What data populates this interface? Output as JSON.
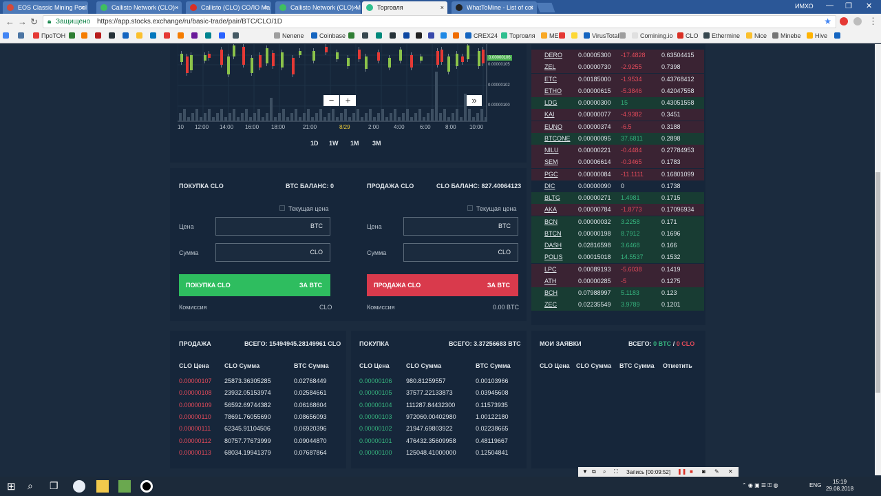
{
  "browser": {
    "tabs": [
      {
        "title": "EOS Classic Mining Pool",
        "left": 0,
        "color": "#d44a3a"
      },
      {
        "title": "Callisto Network (CLO) -",
        "left": 136,
        "color": "#3fbf5f"
      },
      {
        "title": "Callisto (CLO) СОЛО Ма",
        "left": 266,
        "color": "#d93025"
      },
      {
        "title": "Callisto Network (CLO) М",
        "left": 396,
        "color": "#3fbf5f"
      },
      {
        "title": "Торговля",
        "left": 522,
        "color": "#2fbf8f"
      },
      {
        "title": "WhatToMine - List of coi",
        "left": 652,
        "color": "#222222"
      }
    ],
    "user": "ИМХО",
    "secure_label": "Защищено",
    "url": "https://app.stocks.exchange/ru/basic-trade/pair/BTC/CLO/1D",
    "bookmarks": [
      "ПроТОН",
      "Nenene",
      "Coinbase",
      "CREX24",
      "Торговля",
      "ME",
      "VirusTotal",
      "Comining.io",
      "CLO",
      "Ethermine",
      "Nice",
      "Minebe",
      "Hive"
    ]
  },
  "chart": {
    "x_ticks": [
      "10",
      "12:00",
      "14:00",
      "16:00",
      "18:00",
      "21:00",
      "8/29",
      "2:00",
      "4:00",
      "6:00",
      "8:00",
      "10:00"
    ],
    "y_ticks": [
      "0.00000106",
      "0.00000105",
      "0.00000102",
      "0.00000100"
    ],
    "last_price": "0.00000106",
    "ranges": [
      "1D",
      "1W",
      "1M",
      "3M"
    ]
  },
  "buy": {
    "title": "ПОКУПКА CLO",
    "balance": "BTC БАЛАНС: 0",
    "current_price": "Текущая цена",
    "price_label": "Цена",
    "price_unit": "BTC",
    "amount_label": "Сумма",
    "amount_unit": "CLO",
    "button_left": "ПОКУПКА CLO",
    "button_right": "ЗА BTC",
    "fee_label": "Комиссия",
    "fee_value": "CLO"
  },
  "sell": {
    "title": "ПРОДАЖА CLO",
    "balance": "CLO БАЛАНС: 827.40064123",
    "current_price": "Текущая цена",
    "price_label": "Цена",
    "price_unit": "BTC",
    "amount_label": "Сумма",
    "amount_unit": "CLO",
    "button_left": "ПРОДАЖА CLO",
    "button_right": "ЗА BTC",
    "fee_label": "Комиссия",
    "fee_value": "0.00 BTC"
  },
  "asks": {
    "title": "ПРОДАЖА",
    "total": "ВСЕГО: 15494945.28149961 CLO",
    "headers": [
      "CLO Цена",
      "CLO Сумма",
      "BTC Сумма"
    ],
    "rows": [
      [
        "0.00000107",
        "25873.36305285",
        "0.02768449"
      ],
      [
        "0.00000108",
        "23932.05153974",
        "0.02584661"
      ],
      [
        "0.00000109",
        "56592.69744382",
        "0.06168604"
      ],
      [
        "0.00000110",
        "78691.76055690",
        "0.08656093"
      ],
      [
        "0.00000111",
        "62345.91104506",
        "0.06920396"
      ],
      [
        "0.00000112",
        "80757.77673999",
        "0.09044870"
      ],
      [
        "0.00000113",
        "68034.19941379",
        "0.07687864"
      ]
    ]
  },
  "bids": {
    "title": "ПОКУПКА",
    "total": "ВСЕГО: 3.37256683 BTC",
    "headers": [
      "CLO Цена",
      "CLO Сумма",
      "BTC Сумма"
    ],
    "rows": [
      [
        "0.00000106",
        "980.81259557",
        "0.00103966"
      ],
      [
        "0.00000105",
        "37577.22133873",
        "0.03945608"
      ],
      [
        "0.00000104",
        "111287.84432300",
        "0.11573935"
      ],
      [
        "0.00000103",
        "972060.00402980",
        "1.00122180"
      ],
      [
        "0.00000102",
        "21947.69803922",
        "0.02238665"
      ],
      [
        "0.00000101",
        "476432.35609958",
        "0.48119667"
      ],
      [
        "0.00000100",
        "125048.41000000",
        "0.12504841"
      ]
    ]
  },
  "my_orders": {
    "title": "МОИ ЗАЯВКИ",
    "total_prefix": "ВСЕГО:",
    "total_btc": "0 BTC",
    "slash": "/",
    "total_clo": "0 CLO",
    "headers": [
      "CLO Цена",
      "CLO Сумма",
      "BTC Сумма",
      "Отметить"
    ]
  },
  "markets": [
    {
      "sym": "DERO",
      "price": "0.00005300",
      "change": "-17.4828",
      "vol": "0.63504415",
      "dir": "down"
    },
    {
      "sym": "ZEL",
      "price": "0.00000730",
      "change": "-2.9255",
      "vol": "0.7398",
      "dir": "down"
    },
    {
      "sym": "ETC",
      "price": "0.00185000",
      "change": "-1.9534",
      "vol": "0.43768412",
      "dir": "down"
    },
    {
      "sym": "ETHO",
      "price": "0.00000615",
      "change": "-5.3846",
      "vol": "0.42047558",
      "dir": "down"
    },
    {
      "sym": "LDG",
      "price": "0.00000300",
      "change": "15",
      "vol": "0.43051558",
      "dir": "up"
    },
    {
      "sym": "KAI",
      "price": "0.00000077",
      "change": "-4.9382",
      "vol": "0.3451",
      "dir": "down"
    },
    {
      "sym": "EUNO",
      "price": "0.00000374",
      "change": "-6.5",
      "vol": "0.3188",
      "dir": "down"
    },
    {
      "sym": "BTCONE",
      "price": "0.00000095",
      "change": "37.6811",
      "vol": "0.2898",
      "dir": "up"
    },
    {
      "sym": "NILU",
      "price": "0.00000221",
      "change": "-0.4484",
      "vol": "0.27784953",
      "dir": "down"
    },
    {
      "sym": "SEM",
      "price": "0.00006614",
      "change": "-0.3465",
      "vol": "0.1783",
      "dir": "down"
    },
    {
      "sym": "PGC",
      "price": "0.00000084",
      "change": "-11.1111",
      "vol": "0.16801099",
      "dir": "down"
    },
    {
      "sym": "DIC",
      "price": "0.00000090",
      "change": "0",
      "vol": "0.1738",
      "dir": "flat"
    },
    {
      "sym": "BLTG",
      "price": "0.00000271",
      "change": "1.4981",
      "vol": "0.1715",
      "dir": "up"
    },
    {
      "sym": "AKA",
      "price": "0.00000784",
      "change": "-1.8773",
      "vol": "0.17096934",
      "dir": "down"
    },
    {
      "sym": "BCN",
      "price": "0.00000032",
      "change": "3.2258",
      "vol": "0.171",
      "dir": "up"
    },
    {
      "sym": "BTCN",
      "price": "0.00000198",
      "change": "8.7912",
      "vol": "0.1696",
      "dir": "up"
    },
    {
      "sym": "DASH",
      "price": "0.02816598",
      "change": "3.6468",
      "vol": "0.166",
      "dir": "up"
    },
    {
      "sym": "POLIS",
      "price": "0.00015018",
      "change": "14.5537",
      "vol": "0.1532",
      "dir": "up"
    },
    {
      "sym": "LPC",
      "price": "0.00089193",
      "change": "-5.6038",
      "vol": "0.1419",
      "dir": "down"
    },
    {
      "sym": "ATH",
      "price": "0.00000285",
      "change": "-5",
      "vol": "0.1275",
      "dir": "down"
    },
    {
      "sym": "BCH",
      "price": "0.07988997",
      "change": "5.1183",
      "vol": "0.123",
      "dir": "up"
    },
    {
      "sym": "ZEC",
      "price": "0.02235549",
      "change": "3.9789",
      "vol": "0.1201",
      "dir": "up"
    }
  ],
  "recorder": {
    "label": "Запись [00:09:52]"
  },
  "taskbar": {
    "lang": "ENG",
    "time": "15:19",
    "date": "29.08.2018"
  },
  "colors": {
    "buy": "#2ebd5f",
    "sell": "#d93a4c",
    "bg": "#1b2b3e",
    "panel": "#16263a"
  }
}
